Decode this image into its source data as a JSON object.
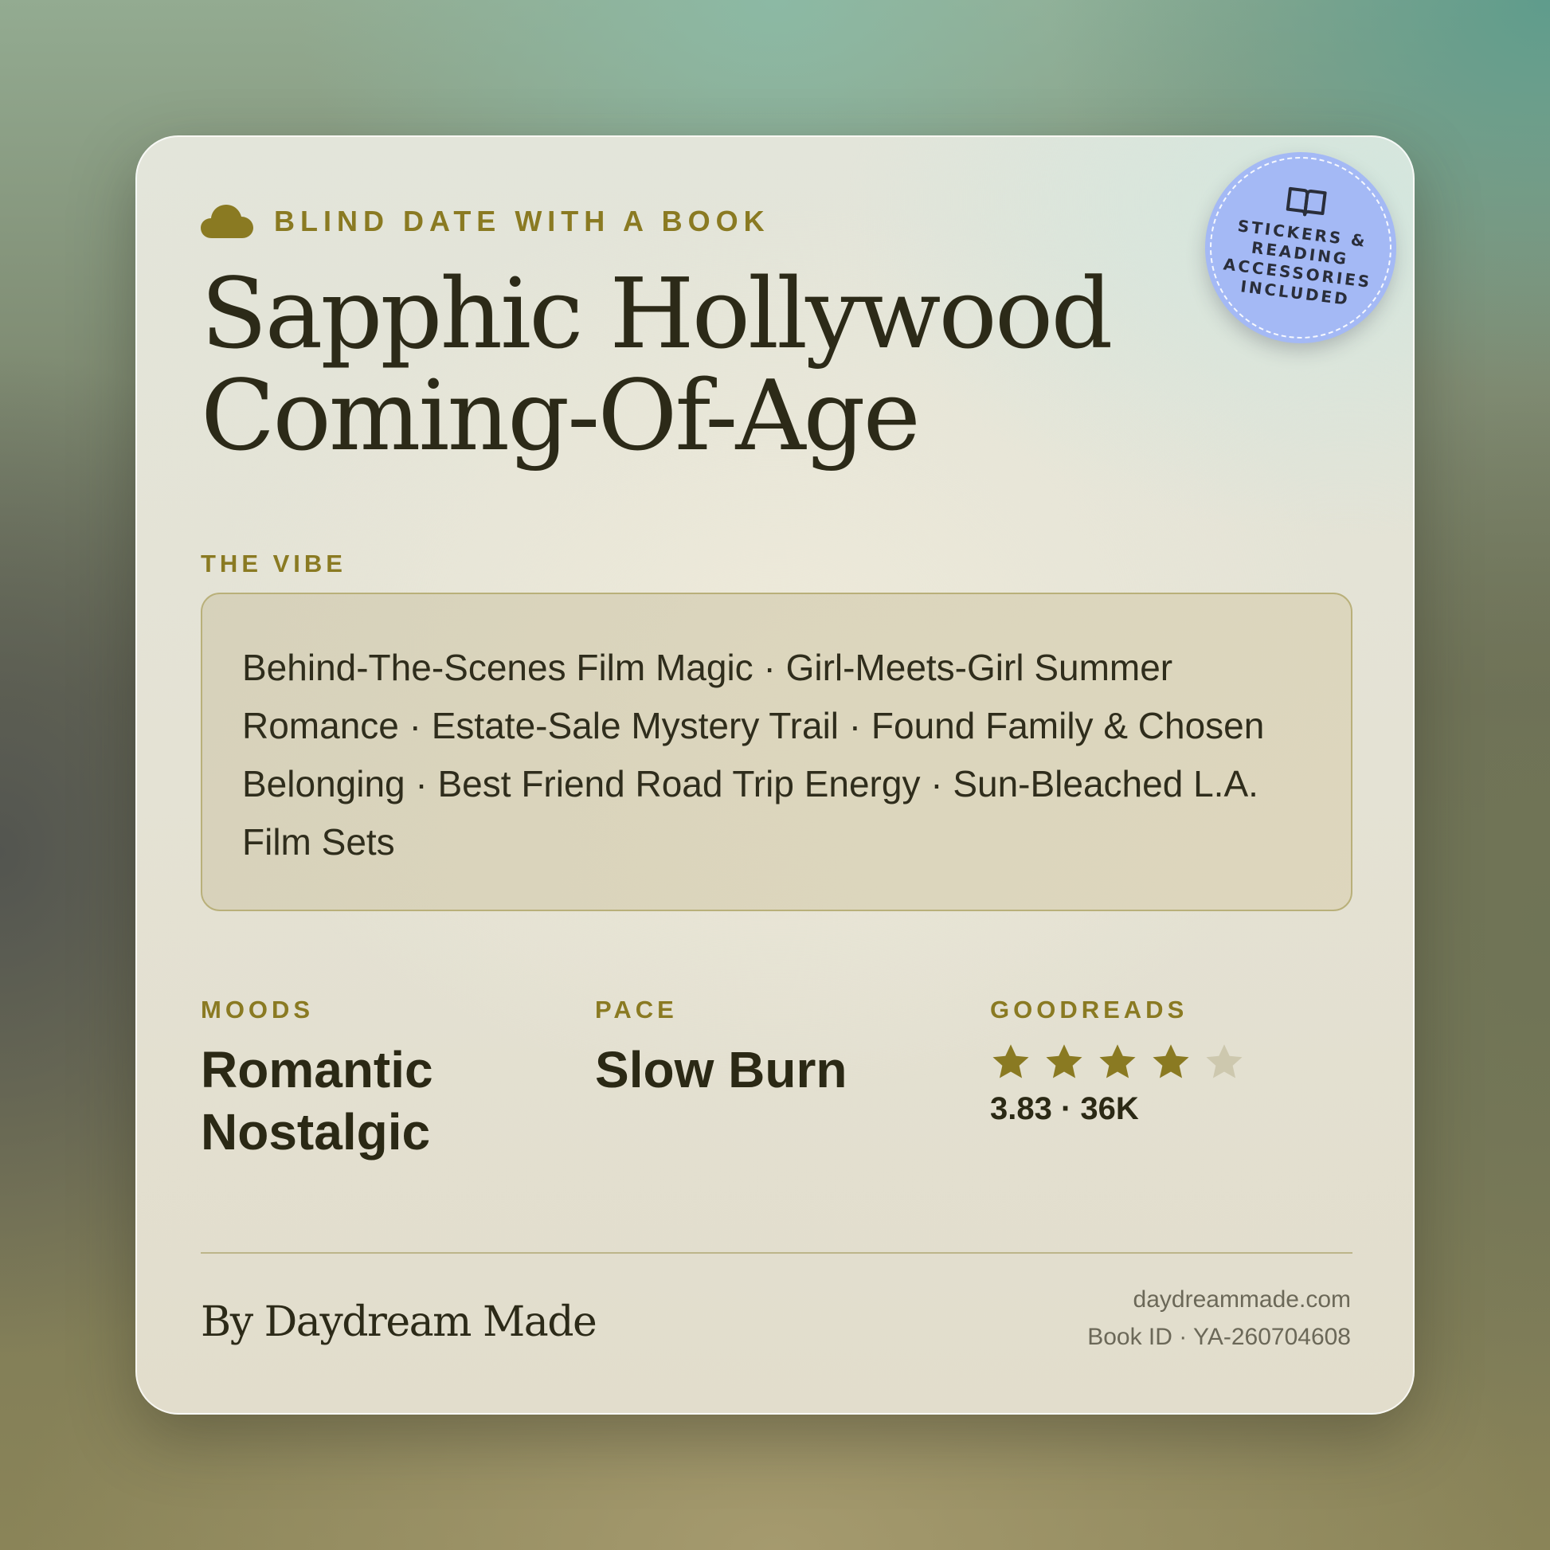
{
  "header": {
    "eyebrow": "BLIND DATE WITH A BOOK",
    "title_line1": "Sapphic Hollywood",
    "title_line2": "Coming-Of-Age"
  },
  "badge": {
    "text": "STICKERS & READING ACCESSORIES INCLUDED",
    "icon": "open-book-icon",
    "color": "#a4b9f5"
  },
  "vibe": {
    "label": "THE VIBE",
    "text": "Behind-The-Scenes Film Magic · Girl-Meets-Girl Summer Romance · Estate-Sale Mystery Trail · Found Family & Chosen Belonging · Best Friend Road Trip Energy · Sun-Bleached L.A. Film Sets"
  },
  "stats": {
    "moods": {
      "label": "MOODS",
      "line1": "Romantic",
      "line2": "Nostalgic"
    },
    "pace": {
      "label": "PACE",
      "value": "Slow Burn"
    },
    "goodreads": {
      "label": "GOODREADS",
      "stars_filled": 4,
      "stars_total": 5,
      "rating_text": "3.83 · 36K"
    }
  },
  "footer": {
    "brand": "By Daydream Made",
    "website": "daydreammade.com",
    "book_id": "Book ID · YA-260704608"
  },
  "colors": {
    "accent": "#8a7a22",
    "text_dark": "#2c2a18",
    "star_filled": "#8a7a22",
    "star_empty": "#cdc8ae"
  }
}
